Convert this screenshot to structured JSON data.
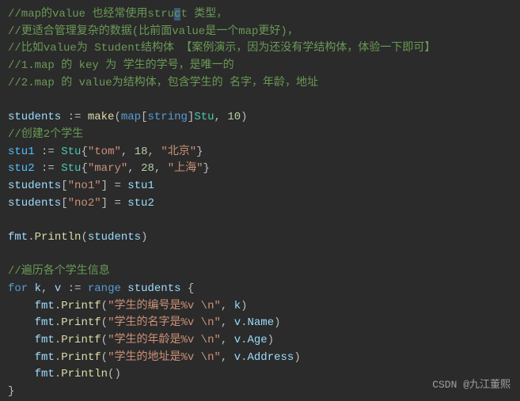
{
  "code": {
    "c1": "//map的value 也经常使用stru",
    "c1s": "c",
    "c1b": "t 类型，",
    "c2": "//更适合管理复杂的数据(比前面value是一个map更好)，",
    "c3": "//比如value为 Student结构体 【案例演示，因为还没有学结构体，体验一下即可】",
    "c4": "//1.map 的 key 为 学生的学号，是唯一的",
    "c5": "//2.map 的 value为结构体，包含学生的 名字，年龄，地址",
    "students_lhs": "students ",
    "assign": ":=",
    "make": "make",
    "map_kw": "map",
    "string_kw": "string",
    "stu_type": "Stu",
    "ten": "10",
    "c6": "//创建2个学生",
    "stu1": "stu1",
    "stu2": "stu2",
    "tom": "\"tom\"",
    "n18": "18",
    "beijing": "\"北京\"",
    "mary": "\"mary\"",
    "n28": "28",
    "shanghai": "\"上海\"",
    "no1": "\"no1\"",
    "no2": "\"no2\"",
    "fmt": "fmt",
    "println": "Println",
    "printf": "Printf",
    "c7": "//遍历各个学生信息",
    "for_kw": "for",
    "range_kw": "range",
    "k": "k",
    "v": "v",
    "s1": "\"学生的编号是%v \\n\"",
    "s2": "\"学生的名字是%v \\n\"",
    "s3": "\"学生的年龄是%v \\n\"",
    "s4": "\"学生的地址是%v \\n\"",
    "name": "Name",
    "age": "Age",
    "address": "Address"
  },
  "watermark": "CSDN @九江董熙"
}
